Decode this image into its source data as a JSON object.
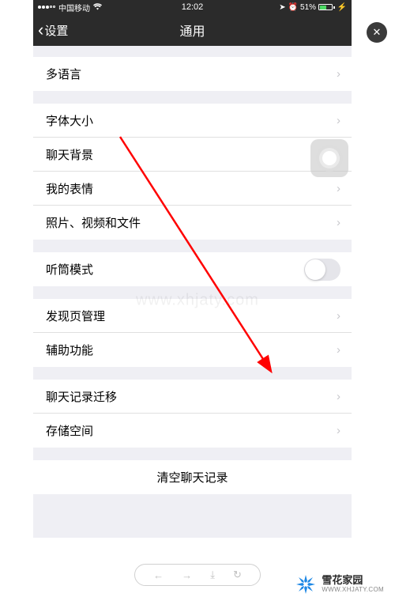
{
  "status_bar": {
    "carrier": "中国移动",
    "time": "12:02",
    "battery_percent": "51%"
  },
  "nav": {
    "back_label": "设置",
    "title": "通用"
  },
  "groups": [
    {
      "rows": [
        {
          "label": "多语言",
          "type": "nav"
        }
      ]
    },
    {
      "rows": [
        {
          "label": "字体大小",
          "type": "nav"
        },
        {
          "label": "聊天背景",
          "type": "nav"
        },
        {
          "label": "我的表情",
          "type": "nav"
        },
        {
          "label": "照片、视频和文件",
          "type": "nav"
        }
      ]
    },
    {
      "rows": [
        {
          "label": "听筒模式",
          "type": "toggle",
          "on": false
        }
      ]
    },
    {
      "rows": [
        {
          "label": "发现页管理",
          "type": "nav"
        },
        {
          "label": "辅助功能",
          "type": "nav"
        }
      ]
    },
    {
      "rows": [
        {
          "label": "聊天记录迁移",
          "type": "nav"
        },
        {
          "label": "存储空间",
          "type": "nav"
        }
      ]
    }
  ],
  "clear_button": "清空聊天记录",
  "watermark_center": "www.xhjaty.com",
  "brand": {
    "cn": "雪花家园",
    "en": "WWW.XHJATY.COM"
  },
  "brand_color": "#1e88e5"
}
